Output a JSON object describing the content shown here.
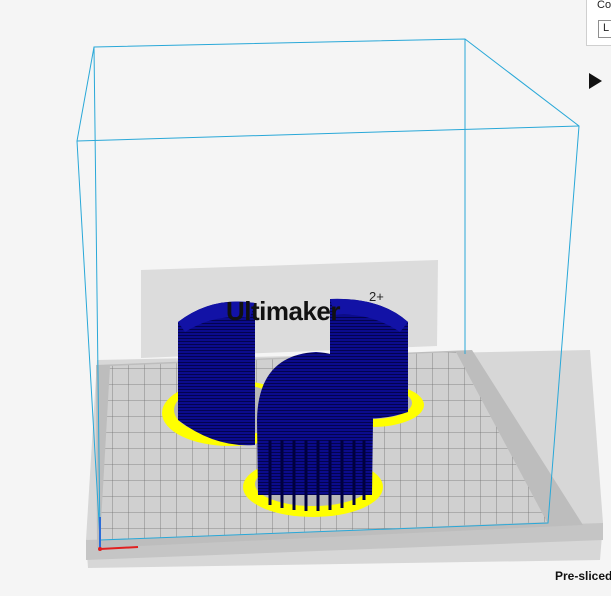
{
  "app": {
    "status_text": "Pre-sliced",
    "view_panel": {
      "title": "Co",
      "field_value": "L"
    },
    "buttons": {
      "play_icon": "play-icon"
    }
  },
  "build_plate": {
    "printer_brand": "Ultimaker",
    "brand_suffix": "2+",
    "volume_outline_color": "#29a8d8",
    "plate_color": "#c9c9c9"
  },
  "models": {
    "color": "#0b0b8c",
    "support_color": "#ffff00",
    "count": 3
  }
}
